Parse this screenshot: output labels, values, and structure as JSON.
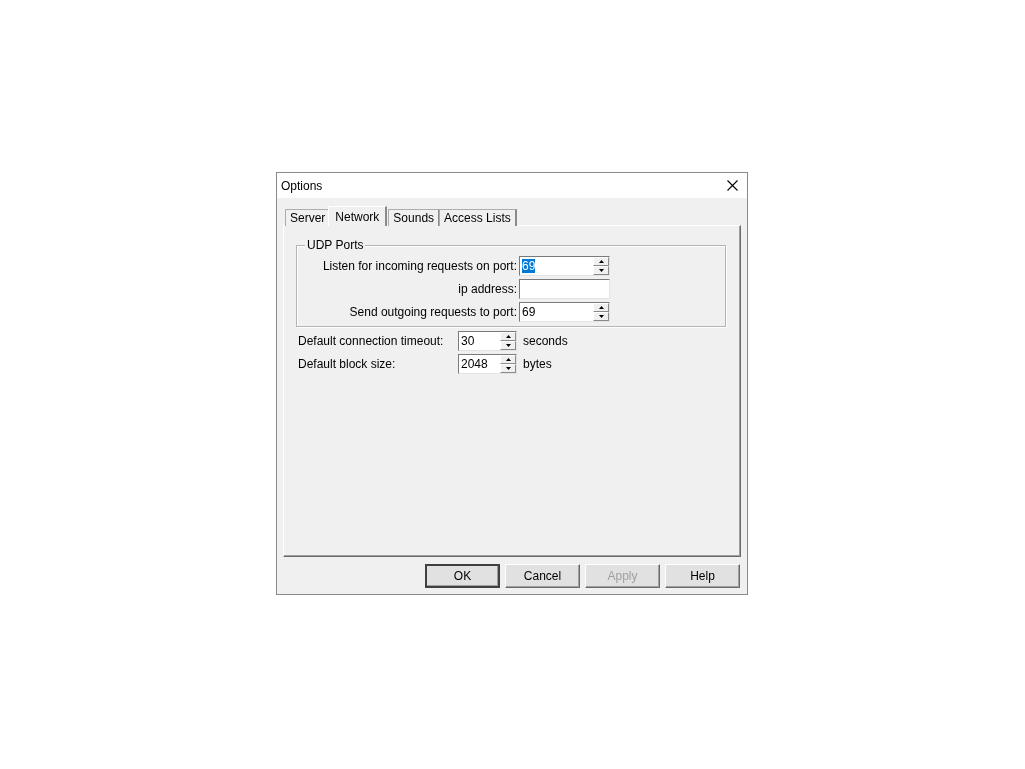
{
  "window": {
    "title": "Options"
  },
  "tabs": [
    {
      "label": "Server",
      "selected": false
    },
    {
      "label": "Network",
      "selected": true
    },
    {
      "label": "Sounds",
      "selected": false
    },
    {
      "label": "Access Lists",
      "selected": false
    }
  ],
  "group": {
    "title": "UDP Ports",
    "fields": [
      {
        "label": "Listen for incoming requests on port:",
        "value": "69",
        "kind": "spin",
        "selected": true
      },
      {
        "label": "ip address:",
        "kind": "text"
      },
      {
        "label": "Send outgoing requests to port:",
        "value": "69",
        "kind": "spin",
        "selected": false
      }
    ]
  },
  "settings": [
    {
      "label": "Default connection timeout:",
      "value": "30",
      "unit": "seconds"
    },
    {
      "label": "Default block size:",
      "value": "2048",
      "unit": "bytes"
    }
  ],
  "buttons": [
    {
      "label": "OK",
      "default": true,
      "disabled": false
    },
    {
      "label": "Cancel",
      "default": false,
      "disabled": false
    },
    {
      "label": "Apply",
      "default": false,
      "disabled": true
    },
    {
      "label": "Help",
      "default": false,
      "disabled": false
    }
  ]
}
